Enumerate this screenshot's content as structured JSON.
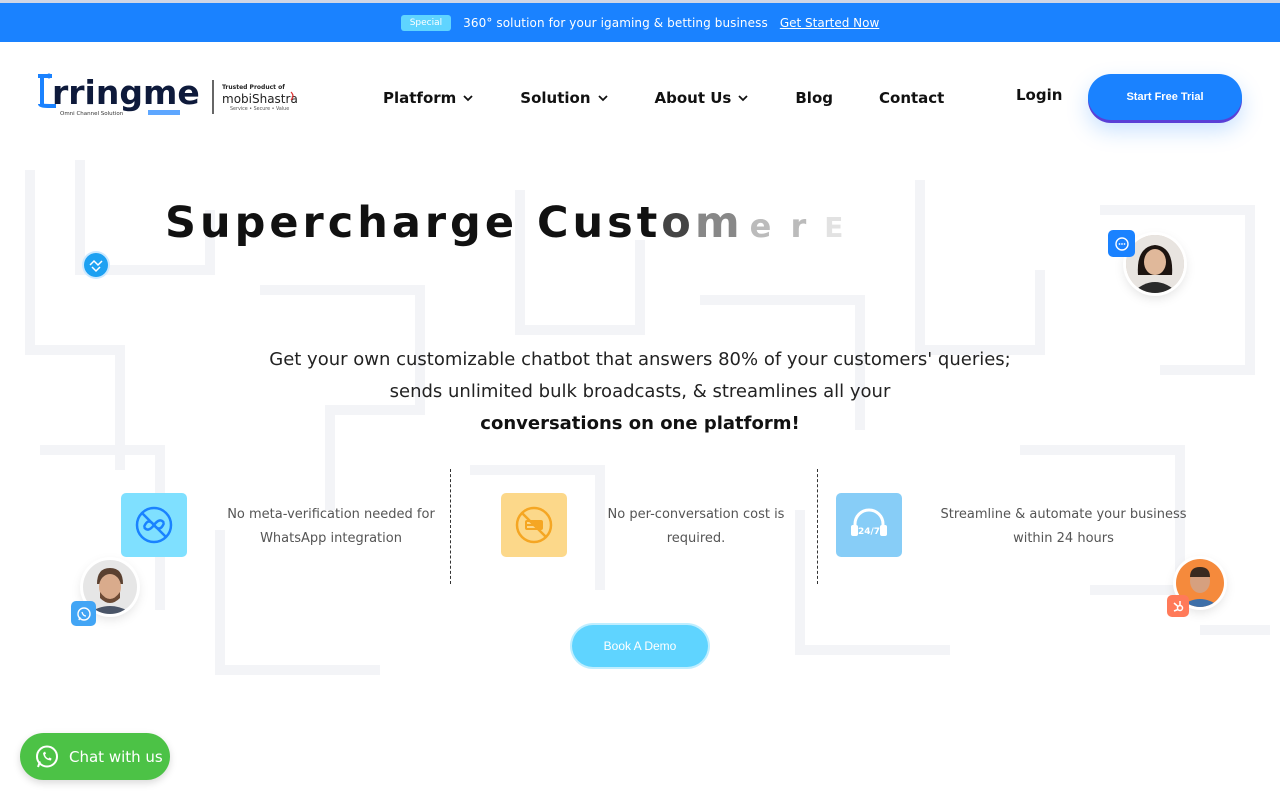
{
  "promo": {
    "badge": "Special",
    "text": "360° solution for your igaming & betting business",
    "link": "Get Started Now"
  },
  "header": {
    "logo_text": "rringme",
    "logo_tagline": "Omni Channel Solution",
    "partner_label": "Trusted Product of",
    "partner_name": "mobiShastra",
    "partner_tagline": "Service • Secure • Value",
    "nav": [
      {
        "label": "Platform",
        "has_dropdown": true
      },
      {
        "label": "Solution",
        "has_dropdown": true
      },
      {
        "label": "About Us",
        "has_dropdown": true
      },
      {
        "label": "Blog",
        "has_dropdown": false
      },
      {
        "label": "Contact",
        "has_dropdown": false
      }
    ],
    "login": "Login",
    "cta": "Start Free Trial"
  },
  "hero": {
    "title_main": "Supercharge Cust",
    "title_fade_1": "o",
    "title_fade_2": "m",
    "title_fade_3": "e r",
    "title_fade_4": "E",
    "desc_line1": "Get your own customizable chatbot that answers 80% of your customers' queries;",
    "desc_line2": "sends unlimited bulk broadcasts, & streamlines all your",
    "desc_line3": "conversations on one platform!",
    "demo_button": "Book A Demo"
  },
  "features": [
    {
      "icon": "no-meta-icon",
      "line1": "No meta-verification needed for",
      "line2": "WhatsApp integration",
      "color": "#7fe0ff"
    },
    {
      "icon": "no-cost-icon",
      "line1": "No per-conversation cost is",
      "line2": "required.",
      "color": "#fcd88a"
    },
    {
      "icon": "support-24-7-icon",
      "line1": "Streamline & automate your business",
      "line2": "within 24 hours",
      "color": "#87cdf7"
    }
  ],
  "support_icon_text": "24/7",
  "chat_widget": {
    "label": "Chat with us"
  },
  "colors": {
    "primary": "#1a82ff",
    "accent_cyan": "#5fd4ff",
    "whatsapp_green": "#4cc246",
    "hubspot_orange": "#ff7a59"
  }
}
